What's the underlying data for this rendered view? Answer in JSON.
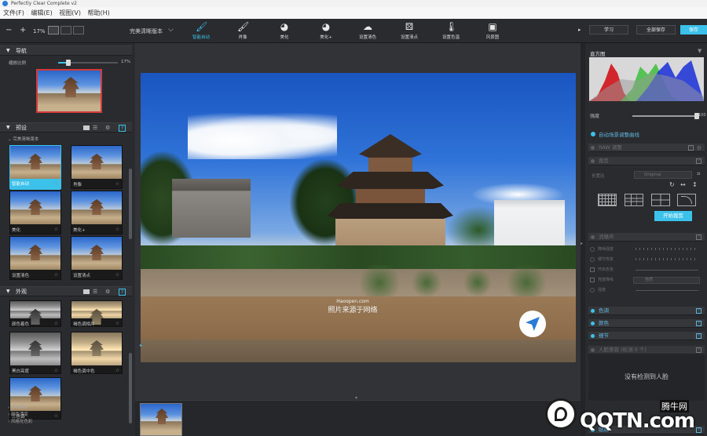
{
  "app": {
    "title": "Perfectly Clear Complete v2"
  },
  "menu": [
    "文件(F)",
    "编辑(E)",
    "视图(V)",
    "帮助(H)"
  ],
  "toolbar": {
    "zoom_minus": "−",
    "zoom_plus": "+",
    "zoom_level": "17%",
    "preset_name": "完美清晰版本",
    "tools": [
      {
        "label": "智能自动",
        "icon": "🖌",
        "active": true
      },
      {
        "label": "肖像",
        "icon": "🖌",
        "active": false
      },
      {
        "label": "美化",
        "icon": "◕",
        "active": false
      },
      {
        "label": "美化+",
        "icon": "◕",
        "active": false
      },
      {
        "label": "设置清色",
        "icon": "☁",
        "active": false
      },
      {
        "label": "设置清点",
        "icon": "⚄",
        "active": false
      },
      {
        "label": "设置色温",
        "icon": "🌡",
        "active": false
      },
      {
        "label": "风景图",
        "icon": "▣",
        "active": false
      }
    ],
    "learn_button": "学习",
    "save_all_button": "全部保存",
    "save_button": "保存"
  },
  "left_panel": {
    "navigator": {
      "title": "导航",
      "zoom_label": "缩放比例",
      "zoom_value": "17%",
      "zoom_fraction": 0.17
    },
    "presets": {
      "title": "预设",
      "group_label": "完美清晰版本",
      "items": [
        {
          "label": "智能自动",
          "selected": true
        },
        {
          "label": "肖像",
          "selected": false
        },
        {
          "label": "美化",
          "selected": false
        },
        {
          "label": "美化+",
          "selected": false
        },
        {
          "label": "设置清色",
          "selected": false
        },
        {
          "label": "设置清点",
          "selected": false
        }
      ]
    },
    "looks": {
      "title": "外观",
      "items": [
        {
          "label": "颜色着色",
          "style": "bw"
        },
        {
          "label": "褐色调相片",
          "style": "sepia"
        },
        {
          "label": "黑白亮度",
          "style": "bw"
        },
        {
          "label": "褐色调中色",
          "style": "sepia"
        },
        {
          "label": "三色调",
          "style": "normal"
        }
      ],
      "groups": [
        "颜色照片",
        "颜色漂变",
        "风格化色彩"
      ]
    }
  },
  "right_panel": {
    "histogram_title": "直方图",
    "strength_label": "强度",
    "strength_value": "100",
    "strength_fraction": 1.0,
    "auto_label": "自动场景调整曲线",
    "sections": [
      {
        "label": "RAW 调整",
        "active": false
      },
      {
        "label": "裁剪",
        "active": false
      }
    ],
    "crop": {
      "ratio_label": "长宽比",
      "ratio_value": "Original",
      "start_button": "开始裁剪"
    },
    "noise": {
      "title": "消噪声",
      "rows": [
        "降噪强度",
        "细节恢复",
        "开启去色",
        "亮度降噪",
        "强度"
      ],
      "mode_value": "自然"
    },
    "color_sections": [
      {
        "label": "色调"
      },
      {
        "label": "颜色"
      },
      {
        "label": "细节"
      }
    ],
    "face_section": "人脸美容 (检测 0 个)",
    "no_face_text": "没有检测到人脸",
    "bottom_section": "眼睛"
  },
  "filmstrip": {
    "count": 1
  },
  "watermark": {
    "site": "腾牛网",
    "domain": "QQTN.com"
  },
  "photo_overlay": {
    "line1": "Haoopen.com",
    "line2": "照片来源于网络"
  }
}
